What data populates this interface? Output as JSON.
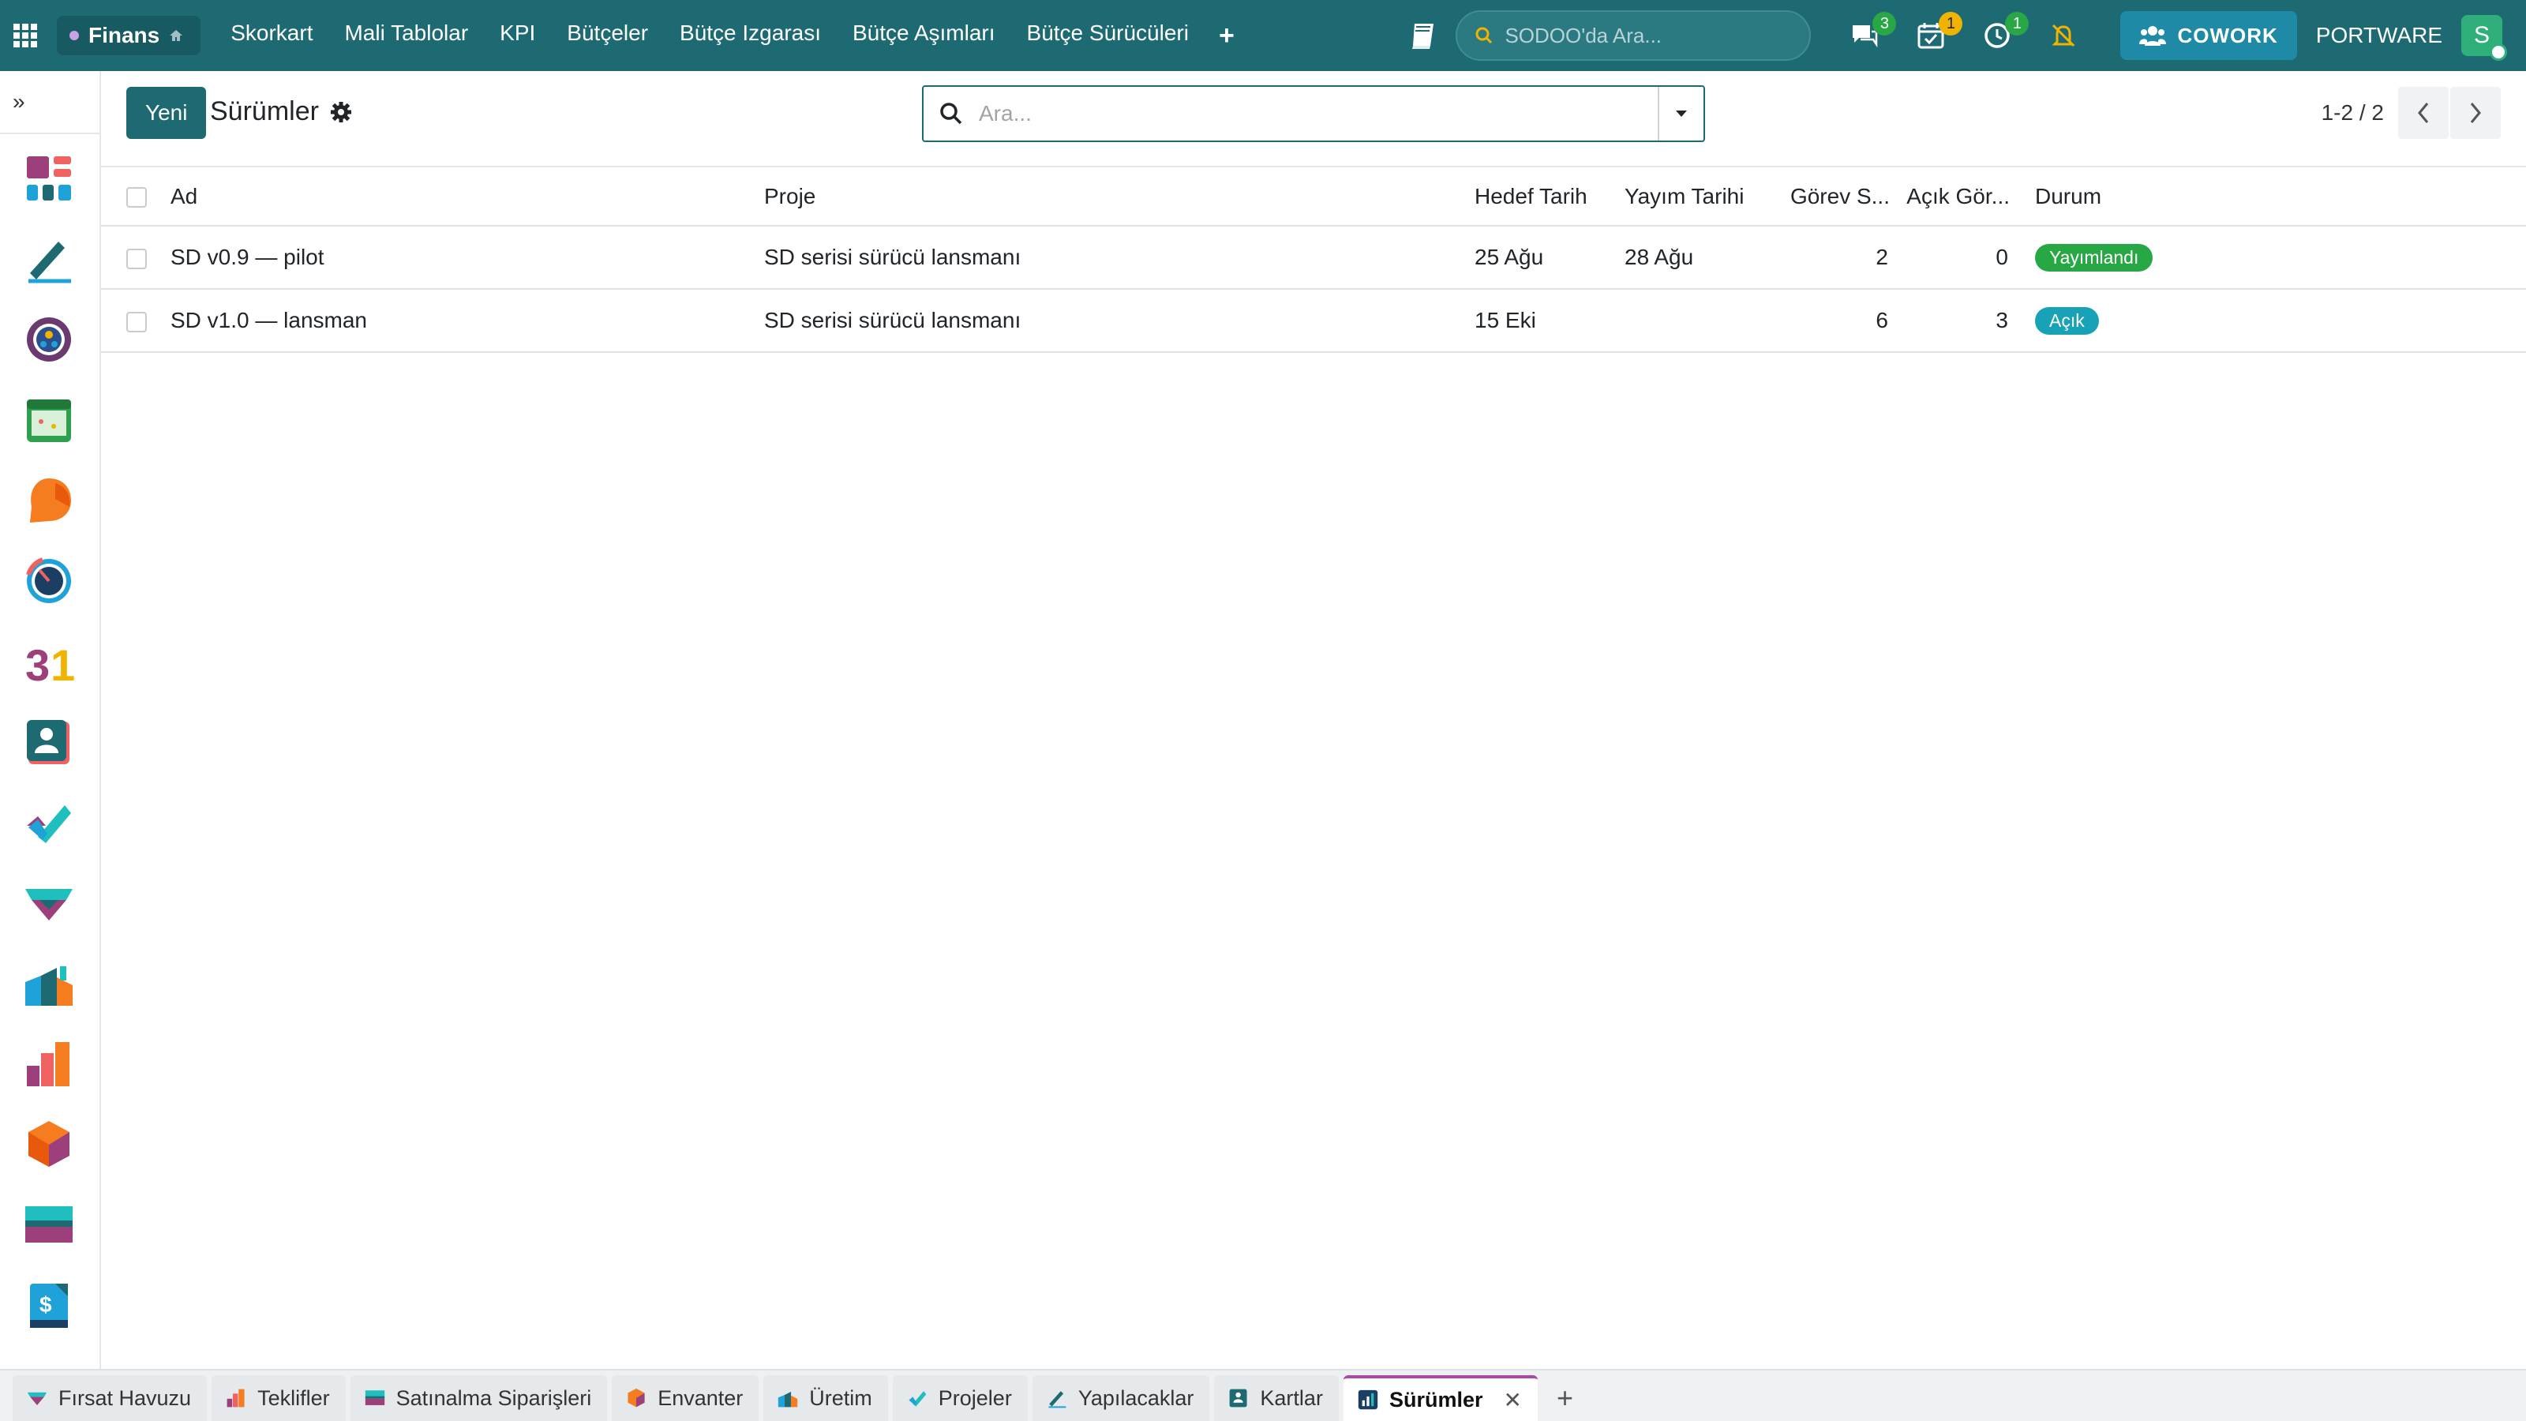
{
  "topnav": {
    "app_name": "Finans",
    "menu": [
      "Skorkart",
      "Mali Tablolar",
      "KPI",
      "Bütçeler",
      "Bütçe Izgarası",
      "Bütçe Aşımları",
      "Bütçe Sürücüleri"
    ],
    "search_placeholder": "SODOO'da Ara...",
    "badges": {
      "messages": "3",
      "activities": "1",
      "timers": "1"
    },
    "cowork_label": "COWORK",
    "company": "PORTWARE",
    "user_initial": "S",
    "colors": {
      "nav_bg": "#1e6a72",
      "cowork_bg": "#1f8aa6",
      "badge_green": "#28a745",
      "badge_yellow": "#f0b400"
    }
  },
  "control": {
    "new_button": "Yeni",
    "title": "Sürümler",
    "search_placeholder": "Ara...",
    "pager": "1-2 / 2"
  },
  "table": {
    "columns": [
      "Ad",
      "Proje",
      "Hedef Tarih",
      "Yayım Tarihi",
      "Görev S...",
      "Açık Gör...",
      "Durum"
    ],
    "rows": [
      {
        "name": "SD v0.9 — pilot",
        "project": "SD serisi sürücü lansmanı",
        "target_date": "25 Ağu",
        "release_date": "28 Ağu",
        "tasks": "2",
        "open_tasks": "0",
        "status": "Yayımlandı",
        "status_color": "#28a745"
      },
      {
        "name": "SD v1.0 — lansman",
        "project": "SD serisi sürücü lansmanı",
        "target_date": "15 Eki",
        "release_date": "",
        "tasks": "6",
        "open_tasks": "3",
        "status": "Açık",
        "status_color": "#17a2b8"
      }
    ]
  },
  "sidebar_apps": [
    "dashboard-icon",
    "pen-icon",
    "team-icon",
    "calendar-icon",
    "chat-bubble-icon",
    "gauge-icon",
    "calendar-31-icon",
    "contact-card-icon",
    "checkmark-icon",
    "handshake-icon",
    "factory-icon",
    "bar-chart-icon",
    "cube-icon",
    "card-icon",
    "invoice-icon"
  ],
  "bottom_tabs": [
    {
      "label": "Fırsat Havuzu",
      "icon": "handshake-icon"
    },
    {
      "label": "Teklifler",
      "icon": "bar-chart-icon"
    },
    {
      "label": "Satınalma Siparişleri",
      "icon": "card-icon"
    },
    {
      "label": "Envanter",
      "icon": "cube-icon"
    },
    {
      "label": "Üretim",
      "icon": "factory-icon"
    },
    {
      "label": "Projeler",
      "icon": "checkmark-icon"
    },
    {
      "label": "Yapılacaklar",
      "icon": "pen-icon"
    },
    {
      "label": "Kartlar",
      "icon": "contact-card-icon"
    },
    {
      "label": "Sürümler",
      "icon": "report-chart-icon",
      "active": true
    }
  ]
}
